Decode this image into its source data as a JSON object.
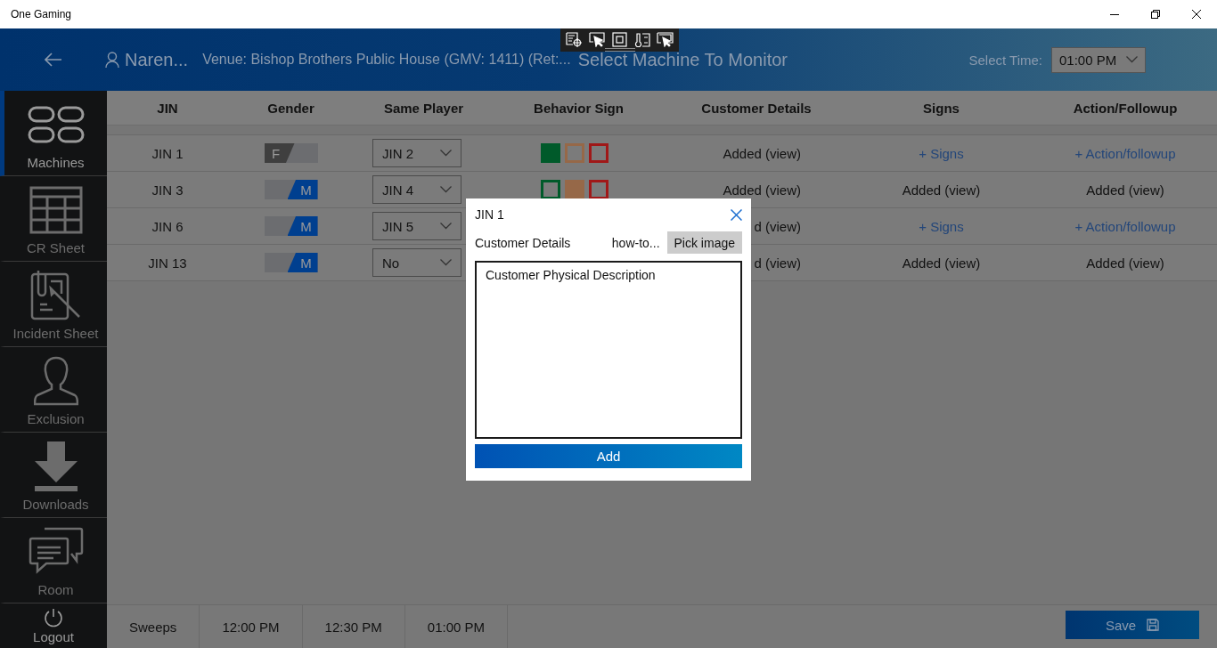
{
  "window": {
    "title": "One Gaming"
  },
  "header": {
    "user": "Naren...",
    "venue": "Venue: Bishop Brothers Public House (GMV: 1411) (Ret:...",
    "title": "Select Machine To Monitor",
    "time_label": "Select Time:",
    "time_value": "01:00 PM"
  },
  "sidebar": {
    "items": [
      {
        "label": "Machines",
        "selected": true
      },
      {
        "label": "CR Sheet",
        "selected": false
      },
      {
        "label": "Incident Sheet",
        "selected": false
      },
      {
        "label": "Exclusion",
        "selected": false
      },
      {
        "label": "Downloads",
        "selected": false
      },
      {
        "label": "Room",
        "selected": false
      }
    ],
    "logout": "Logout"
  },
  "table": {
    "columns": [
      "JIN",
      "Gender",
      "Same Player",
      "Behavior Sign",
      "Customer Details",
      "Signs",
      "Action/Followup"
    ],
    "rows": [
      {
        "jin": "JIN 1",
        "gender": {
          "label": "F",
          "on": false
        },
        "same_player": "JIN 2",
        "behavior_signs": [
          {
            "color": "#005a2a",
            "filled": true
          },
          {
            "color": "#966848",
            "filled": false
          },
          {
            "color": "#a01818",
            "filled": false
          }
        ],
        "customer_details": "Added (view)",
        "signs": {
          "kind": "link",
          "text": "+ Signs"
        },
        "action": {
          "kind": "link",
          "text": "+ Action/followup"
        }
      },
      {
        "jin": "JIN 3",
        "gender": {
          "label": "M",
          "on": true
        },
        "same_player": "JIN 4",
        "behavior_signs": [
          {
            "color": "#005a2a",
            "filled": false
          },
          {
            "color": "#966848",
            "filled": true
          },
          {
            "color": "#a01818",
            "filled": false
          }
        ],
        "customer_details": "Added (view)",
        "signs": {
          "kind": "text",
          "text": "Added (view)"
        },
        "action": {
          "kind": "text",
          "text": "Added (view)"
        }
      },
      {
        "jin": "JIN 6",
        "gender": {
          "label": "M",
          "on": true
        },
        "same_player": "JIN 5",
        "customer_details": "d (view)",
        "signs": {
          "kind": "link",
          "text": "+ Signs"
        },
        "action": {
          "kind": "link",
          "text": "+ Action/followup"
        }
      },
      {
        "jin": "JIN 13",
        "gender": {
          "label": "M",
          "on": true
        },
        "same_player": "No",
        "customer_details": "d (view)",
        "signs": {
          "kind": "text",
          "text": "Added (view)"
        },
        "action": {
          "kind": "text",
          "text": "Added (view)"
        }
      }
    ]
  },
  "bottom_bar": {
    "tabs": [
      {
        "label": "Sweeps",
        "selected": false
      },
      {
        "label": "12:00 PM",
        "selected": false
      },
      {
        "label": "12:30 PM",
        "selected": false
      },
      {
        "label": "01:00 PM",
        "selected": false
      }
    ],
    "save": "Save"
  },
  "dialog": {
    "title": "JIN 1",
    "section": "Customer Details",
    "link": "how-to...",
    "pick_button": "Pick image",
    "description": "Customer Physical Description",
    "add_button": "Add"
  }
}
